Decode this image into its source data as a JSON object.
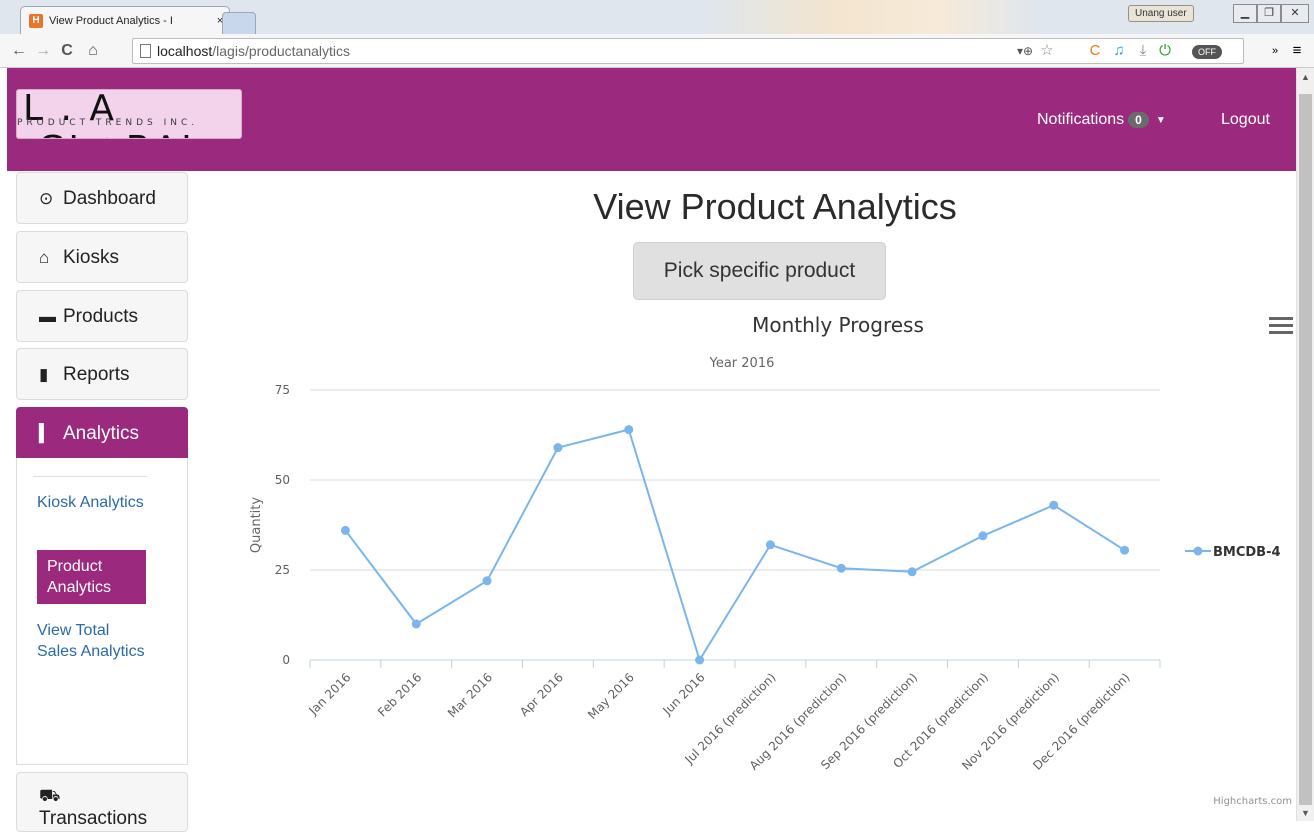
{
  "browser": {
    "tab_title": "View Product Analytics - I",
    "tab_close": "×",
    "profile_label": "Unang user",
    "url_host": "localhost",
    "url_path": "/lagis/productanalytics",
    "toggle_label": "OFF"
  },
  "header": {
    "logo_main": "L . A .GL◎BAL",
    "logo_sub": "PRODUCT TRENDS INC.",
    "notifications_label": "Notifications",
    "notifications_count": "0",
    "logout_label": "Logout"
  },
  "sidebar": {
    "items": [
      {
        "label": "Dashboard",
        "icon": "dashboard-icon",
        "glyph": "⊙"
      },
      {
        "label": "Kiosks",
        "icon": "home-icon",
        "glyph": "⌂"
      },
      {
        "label": "Products",
        "icon": "briefcase-icon",
        "glyph": "▬"
      },
      {
        "label": "Reports",
        "icon": "file-icon",
        "glyph": "▮"
      },
      {
        "label": "Analytics",
        "icon": "bar-chart-icon",
        "glyph": "▍"
      },
      {
        "label": "Transactions",
        "icon": "cart-icon",
        "glyph": "⛟"
      }
    ],
    "analytics_sub": [
      {
        "label": "Kiosk Analytics"
      },
      {
        "label": "Product Analytics"
      },
      {
        "label": "View Total Sales Analytics"
      }
    ]
  },
  "main": {
    "title": "View Product Analytics",
    "pick_button": "Pick specific product",
    "credit": "Highcharts.com"
  },
  "chart_data": {
    "type": "line",
    "title": "Monthly Progress",
    "subtitle": "Year 2016",
    "ylabel": "Quantity",
    "xlabel": "",
    "ylim": [
      0,
      75
    ],
    "yticks": [
      0,
      25,
      50,
      75
    ],
    "grid": true,
    "legend_position": "right",
    "color": "#7cb5ec",
    "categories": [
      "Jan 2016",
      "Feb 2016",
      "Mar 2016",
      "Apr 2016",
      "May 2016",
      "Jun 2016",
      "Jul 2016 (prediction)",
      "Aug 2016 (prediction)",
      "Sep 2016 (prediction)",
      "Oct 2016 (prediction)",
      "Nov 2016 (prediction)",
      "Dec 2016 (prediction)"
    ],
    "series": [
      {
        "name": "BMCDB-4",
        "values": [
          36,
          10,
          22,
          59,
          64,
          0,
          32,
          25.5,
          24.5,
          34.5,
          43,
          30.5
        ]
      }
    ]
  }
}
